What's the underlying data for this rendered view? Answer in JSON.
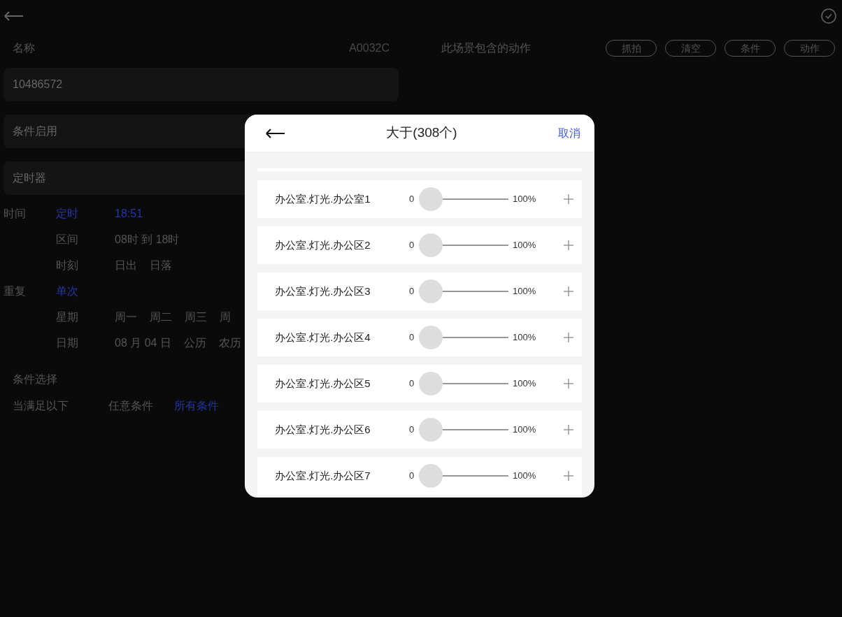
{
  "name_label": "名称",
  "code": "A0032C",
  "name_value": "10486572",
  "fields": [
    {
      "label": "条件启用"
    },
    {
      "label": "定时器"
    }
  ],
  "schedule": [
    {
      "label": "时间",
      "mode": {
        "text": "定时",
        "selected": true
      },
      "values": [
        {
          "text": "18:51",
          "selected": true
        }
      ]
    },
    {
      "mode": {
        "text": "区间",
        "selected": false
      },
      "values": [
        {
          "text": "08时 到 18时",
          "selected": false
        }
      ]
    },
    {
      "mode": {
        "text": "时刻",
        "selected": false
      },
      "values": [
        {
          "text": "日出",
          "selected": false
        },
        {
          "text": "日落",
          "selected": false
        }
      ]
    },
    {
      "label": "重复",
      "mode": {
        "text": "单次",
        "selected": true
      }
    },
    {
      "mode": {
        "text": "星期",
        "selected": false
      },
      "values": [
        {
          "text": "周一",
          "selected": false
        },
        {
          "text": "周二",
          "selected": false
        },
        {
          "text": "周三",
          "selected": false
        },
        {
          "text": "周",
          "selected": false
        }
      ]
    },
    {
      "mode": {
        "text": "日期",
        "selected": false
      },
      "values": [
        {
          "text": "08 月 04 日",
          "selected": false
        },
        {
          "text": "公历",
          "selected": false
        },
        {
          "text": "农历",
          "selected": false
        }
      ]
    }
  ],
  "condition": {
    "title": "条件选择",
    "label": "当满足以下",
    "options": [
      {
        "text": "任意条件",
        "selected": false
      },
      {
        "text": "所有条件",
        "selected": true
      }
    ]
  },
  "actions_title": "此场景包含的动作",
  "action_buttons": [
    "抓拍",
    "清空",
    "条件",
    "动作"
  ],
  "dialog": {
    "title": "大于(308个)",
    "cancel": "取消",
    "items": [
      {
        "name": "办公室.灯光.办公室1",
        "min": "0",
        "max": "100%",
        "level": 0
      },
      {
        "name": "办公室.灯光.办公区2",
        "min": "0",
        "max": "100%",
        "level": 0
      },
      {
        "name": "办公室.灯光.办公区3",
        "min": "0",
        "max": "100%",
        "level": 0
      },
      {
        "name": "办公室.灯光.办公区4",
        "min": "0",
        "max": "100%",
        "level": 0
      },
      {
        "name": "办公室.灯光.办公区5",
        "min": "0",
        "max": "100%",
        "level": 0
      },
      {
        "name": "办公室.灯光.办公区6",
        "min": "0",
        "max": "100%",
        "level": 0
      },
      {
        "name": "办公室.灯光.办公区7",
        "min": "0",
        "max": "100%",
        "level": 0
      }
    ]
  }
}
